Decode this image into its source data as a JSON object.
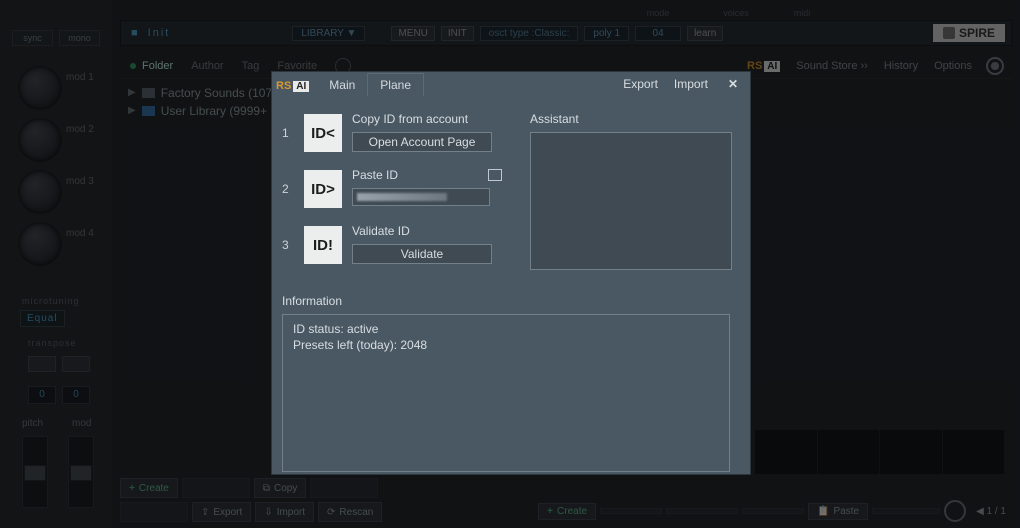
{
  "header": {
    "preset_name": "Init",
    "library_label": "LIBRARY ▼",
    "menu": "MENU",
    "init": "INIT",
    "osc_type": "osct type   :Classic:",
    "mode_label": "mode",
    "mode_value": "poly 1",
    "voices_label": "voices",
    "voices_value": "04",
    "midi_label": "midi",
    "midi_learn": "learn",
    "logo_text": "SPIRE"
  },
  "left": {
    "btn_a": "sync",
    "btn_b": "mono",
    "mod_labels": [
      "mod 1",
      "mod 2",
      "mod 3",
      "mod 4"
    ],
    "microtuning_label": "microtuning",
    "equal_label": "Equal",
    "transpose_label": "transpose",
    "num_a": "0",
    "num_b": "0",
    "pitch_label": "pitch",
    "mod_label": "mod"
  },
  "browser_tabs": {
    "folder": "Folder",
    "author": "Author",
    "tag": "Tag",
    "favorite": "Favorite",
    "sound_store": "Sound Store ››",
    "history": "History",
    "options": "Options"
  },
  "tree": {
    "factory": "Factory Sounds (107",
    "user": "User Library (9999+"
  },
  "bottom": {
    "create": "Create",
    "copy": "Copy",
    "export": "Export",
    "import": "Import",
    "rescan": "Rescan",
    "create2": "Create",
    "paste2": "Paste",
    "page": "1 / 1"
  },
  "dialog": {
    "tab_main": "Main",
    "tab_plane": "Plane",
    "export": "Export",
    "import": "Import",
    "step1": {
      "num": "1",
      "icon": "ID<",
      "title": "Copy ID from account",
      "button": "Open Account Page"
    },
    "step2": {
      "num": "2",
      "icon": "ID>",
      "title": "Paste ID"
    },
    "step3": {
      "num": "3",
      "icon": "ID!",
      "title": "Validate ID",
      "button": "Validate"
    },
    "assistant_title": "Assistant",
    "info_title": "Information",
    "info_line1": "ID status: active",
    "info_line2": "Presets left (today): 2048"
  }
}
